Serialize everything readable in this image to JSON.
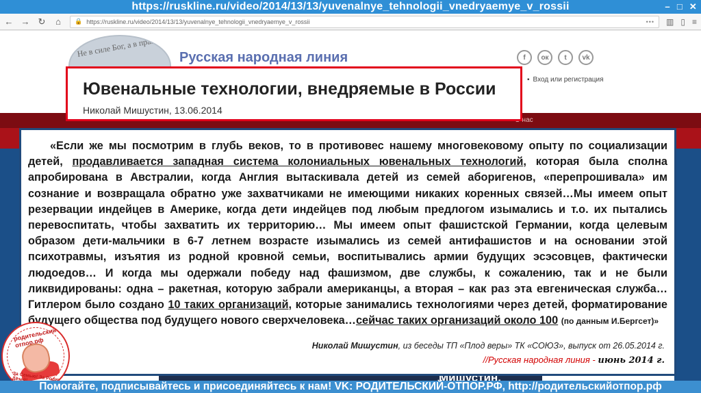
{
  "browser": {
    "url_banner": "https://ruskline.ru/video/2014/13/13/yuvenalnye_tehnologii_vnedryaemye_v_rossii",
    "address": "https://ruskline.ru/video/2014/13/13/yuvenalnye_tehnologii_vnedryaemye_v_rossii",
    "icons": [
      "back-icon",
      "forward-icon",
      "reload-icon",
      "home-icon",
      "lock-icon",
      "menu-icon"
    ]
  },
  "site": {
    "logo_text": "Не в силе Бог, а в правде",
    "title": "Русская народная линия",
    "social": [
      "facebook-icon",
      "odnoklassniki-icon",
      "twitter-icon",
      "vk-icon"
    ],
    "login_label": "Вход или регистрация",
    "nav_right": "О нас",
    "photo_caption": "Мишустин."
  },
  "article": {
    "headline": "Ювенальные технологии, внедряемые в России",
    "byline": "Николай Мишустин, 13.06.2014"
  },
  "quote": {
    "p1": "«Если же мы посмотрим в глубь веков, то в противовес нашему многовековому опыту по социализации детей, ",
    "u1": "продавливается западная система колониальных ювенальных технологий",
    "p2": ", которая была сполна апробирована в Австралии, когда Англия вытаскивала детей из семей аборигенов, «перепрошивала» им сознание и возвращала обратно уже захватчиками не имеющими никаких коренных связей…Мы имеем опыт резервации индейцев в Америке, когда дети индейцев под любым предлогом изымались и т.о. их пытались перевоспитать, чтобы захватить их территорию… Мы имеем опыт фашистской Германии, когда целевым образом дети-мальчики в 6-7 летнем возрасте изымались из семей антифашистов и на основании этой психотравмы, изъятия из родной кровной семьи, воспитывались армии будущих эсэсовцев, фактически людоедов… И когда мы одержали победу над фашизмом, две службы, к сожалению, так и не были ликвидированы: одна – ракетная, которую забрали американцы, а вторая – как раз эта евгеническая служба… Гитлером было создано ",
    "u2": "10 таких организаций",
    "p3": ", которые занимались технологиями через детей, форматирование будущего общества под будущего нового сверхчеловека…",
    "u3": "сейчас таких организаций около 100",
    "p4": " ",
    "small": "(по данным И.Бергсет)»"
  },
  "attribution": {
    "author": "Николай Мишустин",
    "rest": ", из беседы ТП «Плод веры» ТК «СОЮЗ», выпуск от 26.05.2014 г.",
    "source": "//Русская народная линия -",
    "date": "июнь 2014 г."
  },
  "stamp": {
    "text_top": "родительский-отпор.рф",
    "text_bottom": "За Семью! За Родину! За Детей!"
  },
  "footer": {
    "banner": "Помогайте, подписывайтесь и присоединяйтесь к нам! VK: РОДИТЕЛЬСКИЙ-ОТПОР.РФ, http://родительскийотпор.рф"
  }
}
